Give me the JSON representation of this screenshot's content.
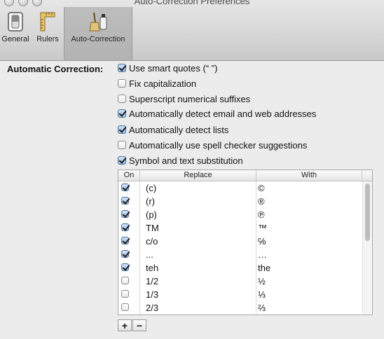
{
  "window": {
    "title": "Auto-Correction Preferences"
  },
  "toolbar": {
    "items": [
      {
        "label": "General",
        "icon": "switch-icon"
      },
      {
        "label": "Rulers",
        "icon": "ruler-icon"
      },
      {
        "label": "Auto-Correction",
        "icon": "broom-icon",
        "selected": true
      }
    ]
  },
  "autocorrect": {
    "section_label": "Automatic Correction:",
    "options": [
      {
        "label": "Use smart quotes (“ ”)",
        "checked": true
      },
      {
        "label": "Fix capitalization",
        "checked": false
      },
      {
        "label": "Superscript numerical suffixes",
        "checked": false
      },
      {
        "label": "Automatically detect email and web addresses",
        "checked": true
      },
      {
        "label": "Automatically detect lists",
        "checked": true
      },
      {
        "label": "Automatically use spell checker suggestions",
        "checked": false
      },
      {
        "label": "Symbol and text substitution",
        "checked": true
      }
    ]
  },
  "substitution_table": {
    "headers": {
      "on": "On",
      "replace": "Replace",
      "with": "With"
    },
    "rows": [
      {
        "on": true,
        "replace": "(c)",
        "with": "©"
      },
      {
        "on": true,
        "replace": "(r)",
        "with": "®"
      },
      {
        "on": true,
        "replace": "(p)",
        "with": "℗"
      },
      {
        "on": true,
        "replace": "TM",
        "with": "™"
      },
      {
        "on": true,
        "replace": "c/o",
        "with": "℅"
      },
      {
        "on": true,
        "replace": "...",
        "with": "…"
      },
      {
        "on": true,
        "replace": "teh",
        "with": "the"
      },
      {
        "on": false,
        "replace": "1/2",
        "with": "½"
      },
      {
        "on": false,
        "replace": "1/3",
        "with": "⅓"
      },
      {
        "on": false,
        "replace": "2/3",
        "with": "⅔"
      }
    ]
  },
  "buttons": {
    "add": "+",
    "remove": "−"
  }
}
